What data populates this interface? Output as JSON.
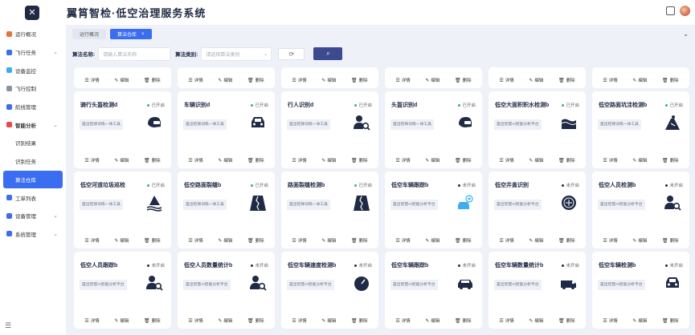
{
  "header": {
    "title": "翼筲智检·低空治理服务系统",
    "logo_glyph": "✕"
  },
  "sidebar": {
    "items": [
      {
        "label": "运行概况",
        "icon_color": "#e8733a",
        "has_arrow": false
      },
      {
        "label": "飞行任务",
        "icon_color": "#3a6df0",
        "has_arrow": true
      },
      {
        "label": "设备监控",
        "icon_color": "#3aaef0",
        "has_arrow": false
      },
      {
        "label": "飞行控制",
        "icon_color": "#8a93a6",
        "has_arrow": false
      },
      {
        "label": "航线管理",
        "icon_color": "#3a6df0",
        "has_arrow": false
      },
      {
        "label": "智能分析",
        "icon_color": "#e84a4a",
        "has_arrow": true,
        "bold": true
      },
      {
        "label": "识别结果",
        "sub": true
      },
      {
        "label": "识别任务",
        "sub": true
      },
      {
        "label": "算法仓库",
        "sub": true,
        "active": true
      },
      {
        "label": "工单列表",
        "icon_color": "#3a6df0",
        "has_arrow": false
      },
      {
        "label": "设备管理",
        "icon_color": "#3a6df0",
        "has_arrow": true
      },
      {
        "label": "系统管理",
        "icon_color": "#3a6df0",
        "has_arrow": true
      }
    ],
    "footer_icon": "menu-icon"
  },
  "tabs": [
    {
      "label": "运行概况",
      "active": false
    },
    {
      "label": "算法仓库",
      "active": true
    }
  ],
  "filters": {
    "name_label": "算法名称:",
    "name_placeholder": "请输入算法名称",
    "type_label": "算法类别:",
    "type_placeholder": "请选择算法类别"
  },
  "actions": {
    "detail": "详情",
    "edit": "编辑",
    "delete": "删除"
  },
  "colors": {
    "accent": "#3a6df0",
    "search": "#3c4a8f",
    "enabled": "#2bb673",
    "disabled": "#1f2a44"
  },
  "cards": [
    {
      "title": "骑行头盔检测d",
      "status": "已开启",
      "enabled": true,
      "desc": "是出检球训练一体工具",
      "icon": "helmet-icon"
    },
    {
      "title": "车辆识别d",
      "status": "已开启",
      "enabled": true,
      "desc": "是出检球训练一体工具",
      "icon": "car-icon"
    },
    {
      "title": "行人识别d",
      "status": "已开启",
      "enabled": true,
      "desc": "是出检球训练一体工具",
      "icon": "person-search-icon"
    },
    {
      "title": "头盔识别d",
      "status": "已开启",
      "enabled": true,
      "desc": "是出检球训练一体工具",
      "icon": "helmet-icon"
    },
    {
      "title": "低空大面积积水检测b",
      "status": "已开启",
      "enabled": true,
      "desc": "是出智慧AI智能分析平台",
      "icon": "water-icon"
    },
    {
      "title": "低空路面坑洼检测b",
      "status": "已开启",
      "enabled": true,
      "desc": "是出检球训练一体工具",
      "icon": "pothole-icon"
    },
    {
      "title": "低空河道垃圾巡检",
      "status": "已开启",
      "enabled": true,
      "desc": "是出检球训练一体工具",
      "icon": "river-icon"
    },
    {
      "title": "低空路面裂缝b",
      "status": "已开启",
      "enabled": true,
      "desc": "是出检球训练一体工具",
      "icon": "road-crack-icon"
    },
    {
      "title": "路面裂缝检测b",
      "status": "已开启",
      "enabled": true,
      "desc": "是出检球训练一体工具",
      "icon": "road-crack-icon"
    },
    {
      "title": "低空车辆跟踪b",
      "status": "未开启",
      "enabled": false,
      "desc": "是出智慧AI智能分析平台",
      "icon": "vehicle-track-icon"
    },
    {
      "title": "低空井盖识别",
      "status": "未开启",
      "enabled": false,
      "desc": "是出智慧AI智能分析平台",
      "icon": "manhole-icon"
    },
    {
      "title": "低空人员检测b",
      "status": "未开启",
      "enabled": false,
      "desc": "是出智慧AI智能分析平台",
      "icon": "person-search-icon"
    },
    {
      "title": "低空人员跟踪b",
      "status": "未开启",
      "enabled": false,
      "desc": "是出智慧AI智能分析平台",
      "icon": "person-search-icon"
    },
    {
      "title": "低空人员数量统计b",
      "status": "未开启",
      "enabled": false,
      "desc": "是出智慧AI智能分析平台",
      "icon": "person-search-icon"
    },
    {
      "title": "低空车辆速度检测b",
      "status": "未开启",
      "enabled": false,
      "desc": "是出智慧AI智能分析平台",
      "icon": "speedometer-icon"
    },
    {
      "title": "低空车辆跟踪b",
      "status": "未开启",
      "enabled": false,
      "desc": "是出智慧AI智能分析平台",
      "icon": "car-front-icon"
    },
    {
      "title": "低空车辆数量统计b",
      "status": "未开启",
      "enabled": false,
      "desc": "是出智慧AI智能分析平台",
      "icon": "van-icon"
    },
    {
      "title": "低空车辆检测b",
      "status": "未开启",
      "enabled": false,
      "desc": "是出智慧AI智能分析平台",
      "icon": "car-icon"
    }
  ]
}
